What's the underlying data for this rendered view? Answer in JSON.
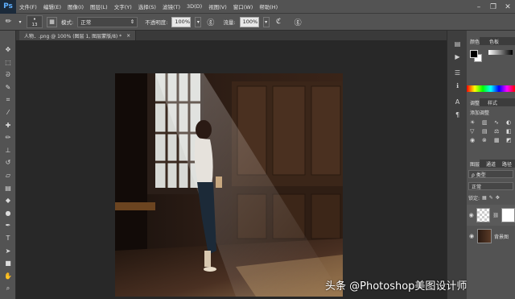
{
  "app": {
    "logo": "Ps"
  },
  "menu": {
    "items": [
      "文件(F)",
      "编辑(E)",
      "图像(I)",
      "图层(L)",
      "文字(Y)",
      "选择(S)",
      "滤镜(T)",
      "3D(D)",
      "视图(V)",
      "窗口(W)",
      "帮助(H)"
    ]
  },
  "window_controls": {
    "minimize": "–",
    "restore": "❐",
    "close": "✕"
  },
  "options": {
    "brush_size": "13",
    "mode_label": "模式:",
    "mode_value": "正常",
    "opacity_label": "不透明度:",
    "opacity_value": "100%",
    "flow_label": "流量:",
    "flow_value": "100%"
  },
  "document": {
    "tab_title": "人物．.png @ 100% (图层 1, 图层蒙版/8) *",
    "tab_close": "×"
  },
  "tools": [
    {
      "name": "move-tool-icon",
      "glyph": "✥"
    },
    {
      "name": "marquee-tool-icon",
      "glyph": "⬚"
    },
    {
      "name": "lasso-tool-icon",
      "glyph": "ᘐ"
    },
    {
      "name": "quick-select-tool-icon",
      "glyph": "✎"
    },
    {
      "name": "crop-tool-icon",
      "glyph": "⌗"
    },
    {
      "name": "eyedropper-tool-icon",
      "glyph": "⁄"
    },
    {
      "name": "healing-tool-icon",
      "glyph": "✚"
    },
    {
      "name": "brush-tool-icon",
      "glyph": "✏"
    },
    {
      "name": "clone-stamp-tool-icon",
      "glyph": "⊥"
    },
    {
      "name": "history-brush-tool-icon",
      "glyph": "↺"
    },
    {
      "name": "eraser-tool-icon",
      "glyph": "▱"
    },
    {
      "name": "gradient-tool-icon",
      "glyph": "▤"
    },
    {
      "name": "blur-tool-icon",
      "glyph": "◆"
    },
    {
      "name": "dodge-tool-icon",
      "glyph": "●"
    },
    {
      "name": "pen-tool-icon",
      "glyph": "✒"
    },
    {
      "name": "type-tool-icon",
      "glyph": "T"
    },
    {
      "name": "path-select-tool-icon",
      "glyph": "➤"
    },
    {
      "name": "shape-tool-icon",
      "glyph": "■"
    },
    {
      "name": "hand-tool-icon",
      "glyph": "✋"
    },
    {
      "name": "zoom-tool-icon",
      "glyph": "⌕"
    }
  ],
  "panels": {
    "color_tab": "颜色",
    "swatches_tab": "色板",
    "adjust_tab": "调整",
    "styles_tab": "样式",
    "add_adjustment": "添加调整",
    "layers_tab": "图层",
    "channels_tab": "通道",
    "paths_tab": "路径",
    "kind_label": "ρ 类型",
    "blend_mode": "正常",
    "lock_label": "锁定:",
    "layer_bg_name": "背景图"
  },
  "watermark": "头条 @Photoshop美图设计师",
  "colors": {
    "ui": "#535353",
    "canvas_bg": "#282828",
    "fg_swatch": "#000000",
    "bg_swatch": "#ffffff"
  }
}
